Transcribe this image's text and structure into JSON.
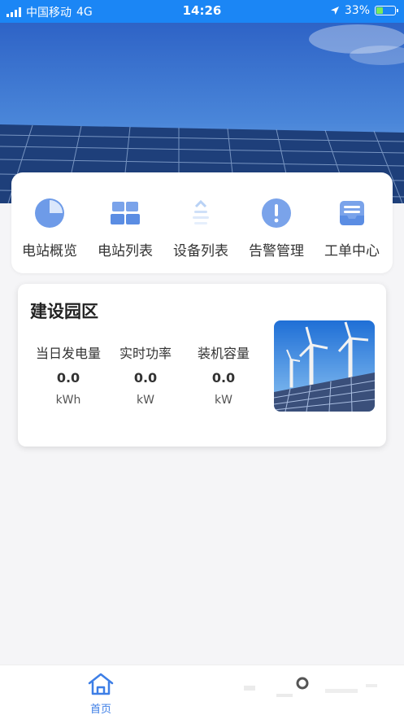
{
  "status_bar": {
    "carrier": "中国移动",
    "network": "4G",
    "time": "14:26",
    "battery": "33%"
  },
  "menu": {
    "items": [
      {
        "label": "电站概览",
        "icon": "pie-chart-icon"
      },
      {
        "label": "电站列表",
        "icon": "grid-list-icon"
      },
      {
        "label": "设备列表",
        "icon": "device-icon"
      },
      {
        "label": "告警管理",
        "icon": "alert-icon"
      },
      {
        "label": "工单中心",
        "icon": "inbox-icon"
      }
    ]
  },
  "site": {
    "name": "建设园区",
    "stats": [
      {
        "label": "当日发电量",
        "value": "0.0",
        "unit": "kWh"
      },
      {
        "label": "实时功率",
        "value": "0.0",
        "unit": "kW"
      },
      {
        "label": "装机容量",
        "value": "0.0",
        "unit": "kW"
      }
    ]
  },
  "tabbar": {
    "home_label": "首页"
  },
  "colors": {
    "status_bar": "#1b86f5",
    "accent": "#3d7ee6",
    "icon_blue": "#6e9be8"
  }
}
